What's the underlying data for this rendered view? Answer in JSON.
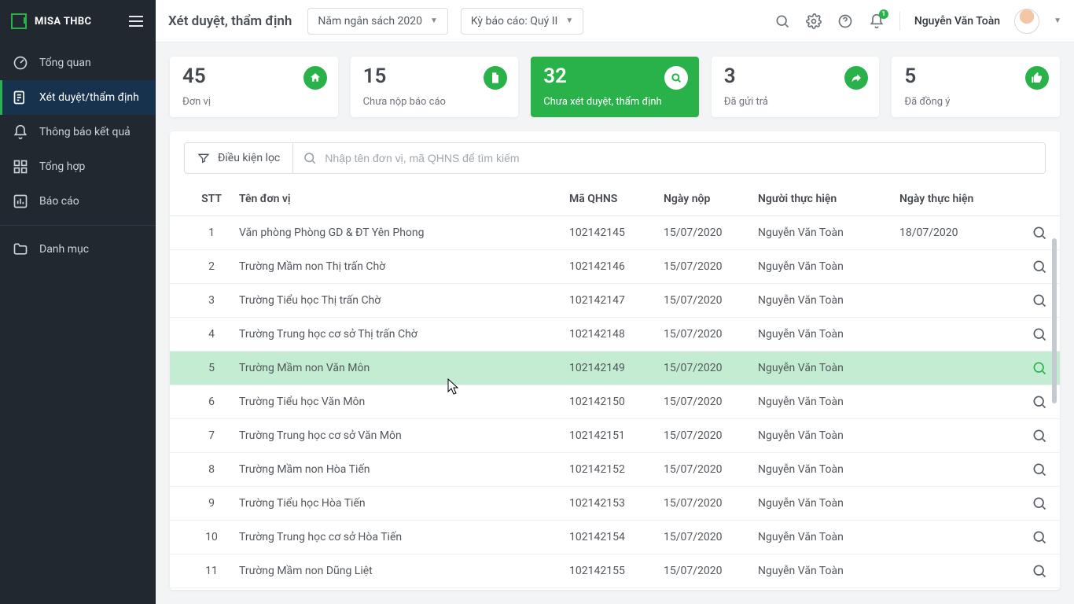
{
  "brand": {
    "name": "MISA THBC"
  },
  "sidebar": {
    "items": [
      {
        "label": "Tổng quan"
      },
      {
        "label": "Xét duyệt/thẩm định"
      },
      {
        "label": "Thông báo kết quả"
      },
      {
        "label": "Tổng hợp"
      },
      {
        "label": "Báo cáo"
      },
      {
        "label": "Danh mục"
      }
    ]
  },
  "header": {
    "title": "Xét duyệt, thẩm định",
    "budget_year": "Năm ngân sách 2020",
    "report_period": "Kỳ báo cáo: Quý II",
    "user": "Nguyễn Văn Toàn",
    "notif_count": "1"
  },
  "cards": [
    {
      "value": "45",
      "label": "Đơn vị",
      "icon": "home"
    },
    {
      "value": "15",
      "label": "Chưa nộp báo cáo",
      "icon": "file"
    },
    {
      "value": "32",
      "label": "Chưa xét duyệt, thẩm định",
      "icon": "search",
      "active": true
    },
    {
      "value": "3",
      "label": "Đã gửi trả",
      "icon": "reply"
    },
    {
      "value": "5",
      "label": "Đã đồng ý",
      "icon": "thumb"
    }
  ],
  "filter": {
    "button": "Điều kiện lọc",
    "placeholder": "Nhập tên đơn vị, mã QHNS để tìm kiếm"
  },
  "table": {
    "headers": {
      "stt": "STT",
      "name": "Tên đơn vị",
      "code": "Mã QHNS",
      "sdate": "Ngày nộp",
      "actor": "Người thực hiện",
      "adate": "Ngày thực hiện"
    },
    "rows": [
      {
        "i": "1",
        "name": "Văn phòng Phòng GD & ĐT Yên Phong",
        "code": "102142145",
        "sdate": "15/07/2020",
        "actor": "Nguyễn Văn Toàn",
        "adate": "18/07/2020"
      },
      {
        "i": "2",
        "name": "Trường Mầm non Thị trấn Chờ",
        "code": "102142146",
        "sdate": "15/07/2020",
        "actor": "Nguyễn Văn Toàn",
        "adate": ""
      },
      {
        "i": "3",
        "name": "Trường Tiểu học Thị trấn Chờ",
        "code": "102142147",
        "sdate": "15/07/2020",
        "actor": "Nguyễn Văn Toàn",
        "adate": ""
      },
      {
        "i": "4",
        "name": "Trường Trung học cơ sở Thị trấn Chờ",
        "code": "102142148",
        "sdate": "15/07/2020",
        "actor": "Nguyễn Văn Toàn",
        "adate": ""
      },
      {
        "i": "5",
        "name": "Trường Mầm non Văn Môn",
        "code": "102142149",
        "sdate": "15/07/2020",
        "actor": "Nguyễn Văn Toàn",
        "adate": "",
        "hover": true
      },
      {
        "i": "6",
        "name": "Trường Tiểu học Văn Môn",
        "code": "102142150",
        "sdate": "15/07/2020",
        "actor": "Nguyễn Văn Toàn",
        "adate": ""
      },
      {
        "i": "7",
        "name": "Trường Trung học cơ sở Văn Môn",
        "code": "102142151",
        "sdate": "15/07/2020",
        "actor": "Nguyễn Văn Toàn",
        "adate": ""
      },
      {
        "i": "8",
        "name": "Trường Mầm non Hòa Tiến",
        "code": "102142152",
        "sdate": "15/07/2020",
        "actor": "Nguyễn Văn Toàn",
        "adate": ""
      },
      {
        "i": "9",
        "name": "Trường Tiểu học Hòa Tiến",
        "code": "102142153",
        "sdate": "15/07/2020",
        "actor": "Nguyễn Văn Toàn",
        "adate": ""
      },
      {
        "i": "10",
        "name": "Trường Trung học cơ sở Hòa Tiến",
        "code": "102142154",
        "sdate": "15/07/2020",
        "actor": "Nguyễn Văn Toàn",
        "adate": ""
      },
      {
        "i": "11",
        "name": "Trường Mầm non Dũng Liệt",
        "code": "102142155",
        "sdate": "15/07/2020",
        "actor": "Nguyễn Văn Toàn",
        "adate": ""
      }
    ]
  }
}
